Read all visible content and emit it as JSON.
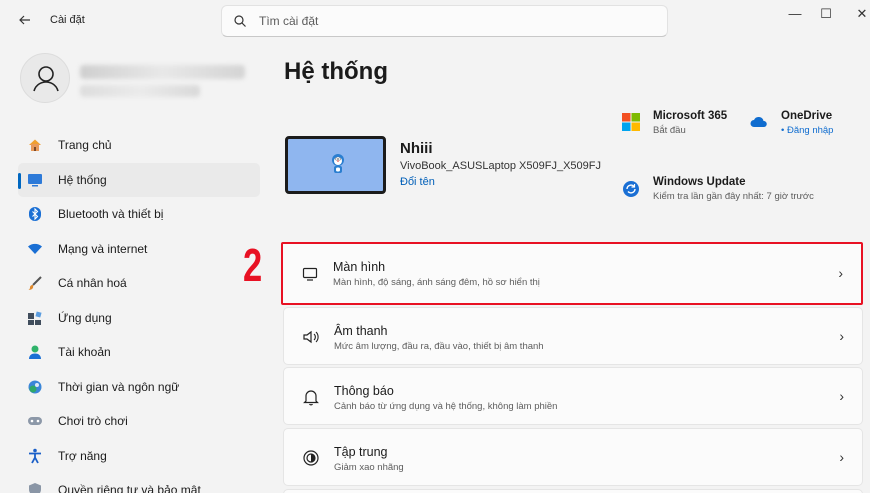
{
  "app": {
    "title": "Cài đặt"
  },
  "search": {
    "placeholder": "Tìm cài đặt"
  },
  "window": {
    "minimize": "—",
    "maximize": "☐",
    "close": "✕"
  },
  "sidebar": {
    "items": [
      {
        "label": "Trang chủ",
        "icon": "home-icon",
        "active": false
      },
      {
        "label": "Hệ thống",
        "icon": "system-icon",
        "active": true
      },
      {
        "label": "Bluetooth và thiết bị",
        "icon": "bluetooth-icon",
        "active": false
      },
      {
        "label": "Mạng và internet",
        "icon": "wifi-icon",
        "active": false
      },
      {
        "label": "Cá nhân hoá",
        "icon": "brush-icon",
        "active": false
      },
      {
        "label": "Ứng dụng",
        "icon": "apps-icon",
        "active": false
      },
      {
        "label": "Tài khoản",
        "icon": "account-icon",
        "active": false
      },
      {
        "label": "Thời gian và ngôn ngữ",
        "icon": "globe-clock-icon",
        "active": false
      },
      {
        "label": "Chơi trò chơi",
        "icon": "gamepad-icon",
        "active": false
      },
      {
        "label": "Trợ năng",
        "icon": "accessibility-icon",
        "active": false
      },
      {
        "label": "Quyền riêng tư và bảo mật",
        "icon": "shield-icon",
        "active": false
      }
    ]
  },
  "main": {
    "title": "Hệ thống",
    "device": {
      "name": "Nhiii",
      "model": "VivoBook_ASUSLaptop X509FJ_X509FJ",
      "rename": "Đổi tên"
    },
    "quick": {
      "ms365": {
        "title": "Microsoft 365",
        "sub": "Bắt đầu"
      },
      "onedrive": {
        "title": "OneDrive",
        "sub": "• Đăng nhập"
      },
      "update": {
        "title": "Windows Update",
        "sub": "Kiểm tra lần gần đây nhất: 7 giờ trước"
      }
    },
    "annotation": "2",
    "cards": [
      {
        "title": "Màn hình",
        "sub": "Màn hình, độ sáng, ánh sáng đêm, hồ sơ hiển thị",
        "icon": "display-icon",
        "highlight": true
      },
      {
        "title": "Âm thanh",
        "sub": "Mức âm lượng, đầu ra, đầu vào, thiết bị âm thanh",
        "icon": "speaker-icon",
        "highlight": false
      },
      {
        "title": "Thông báo",
        "sub": "Cảnh báo từ ứng dụng và hệ thống, không làm phiền",
        "icon": "bell-icon",
        "highlight": false
      },
      {
        "title": "Tập trung",
        "sub": "Giảm xao nhãng",
        "icon": "focus-icon",
        "highlight": false
      }
    ]
  },
  "colors": {
    "accent": "#0067c0",
    "highlight": "#e81123",
    "link": "#005fb8"
  }
}
